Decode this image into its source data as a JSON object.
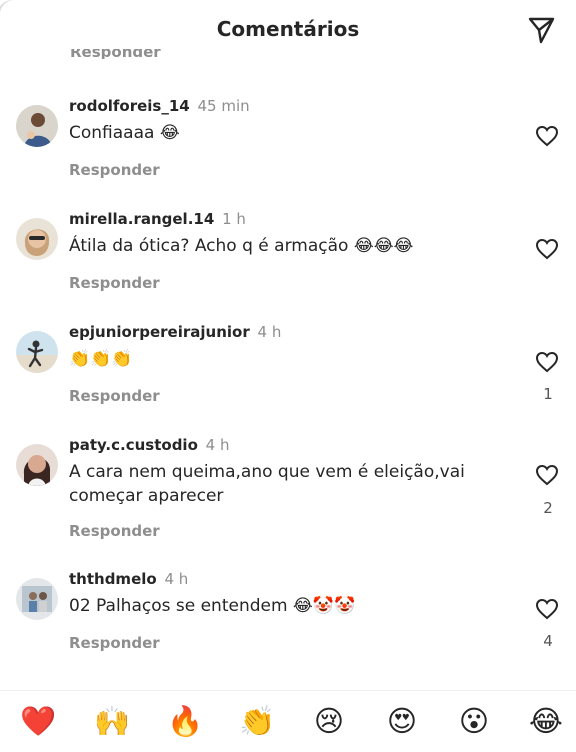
{
  "header": {
    "title": "Comentários",
    "send_icon": "paper-plane-icon"
  },
  "previous_reply_label": "Responder",
  "comments": [
    {
      "username": "rodolforeis_14",
      "time": "45 min",
      "text": "Confiaaaa 😂",
      "reply_label": "Responder",
      "likes": ""
    },
    {
      "username": "mirella.rangel.14",
      "time": "1 h",
      "text": "Átila da ótica? Acho q é armação 😂😂😂",
      "reply_label": "Responder",
      "likes": ""
    },
    {
      "username": "epjuniorpereirajunior",
      "time": "4 h",
      "text": "👏👏👏",
      "reply_label": "Responder",
      "likes": "1"
    },
    {
      "username": "paty.c.custodio",
      "time": "4 h",
      "text": "A cara nem queima,ano que vem é eleição,vai começar aparecer",
      "reply_label": "Responder",
      "likes": "2"
    },
    {
      "username": "ththdmelo",
      "time": "4 h",
      "text": "02 Palhaços se entendem 😂🤡🤡",
      "reply_label": "Responder",
      "likes": "4"
    }
  ],
  "reactions": [
    "❤️",
    "🙌",
    "🔥",
    "👏",
    "😢",
    "😍",
    "😮",
    "😂"
  ],
  "colors": {
    "text": "#262626",
    "muted": "#8e8e8e",
    "background": "#ffffff"
  }
}
